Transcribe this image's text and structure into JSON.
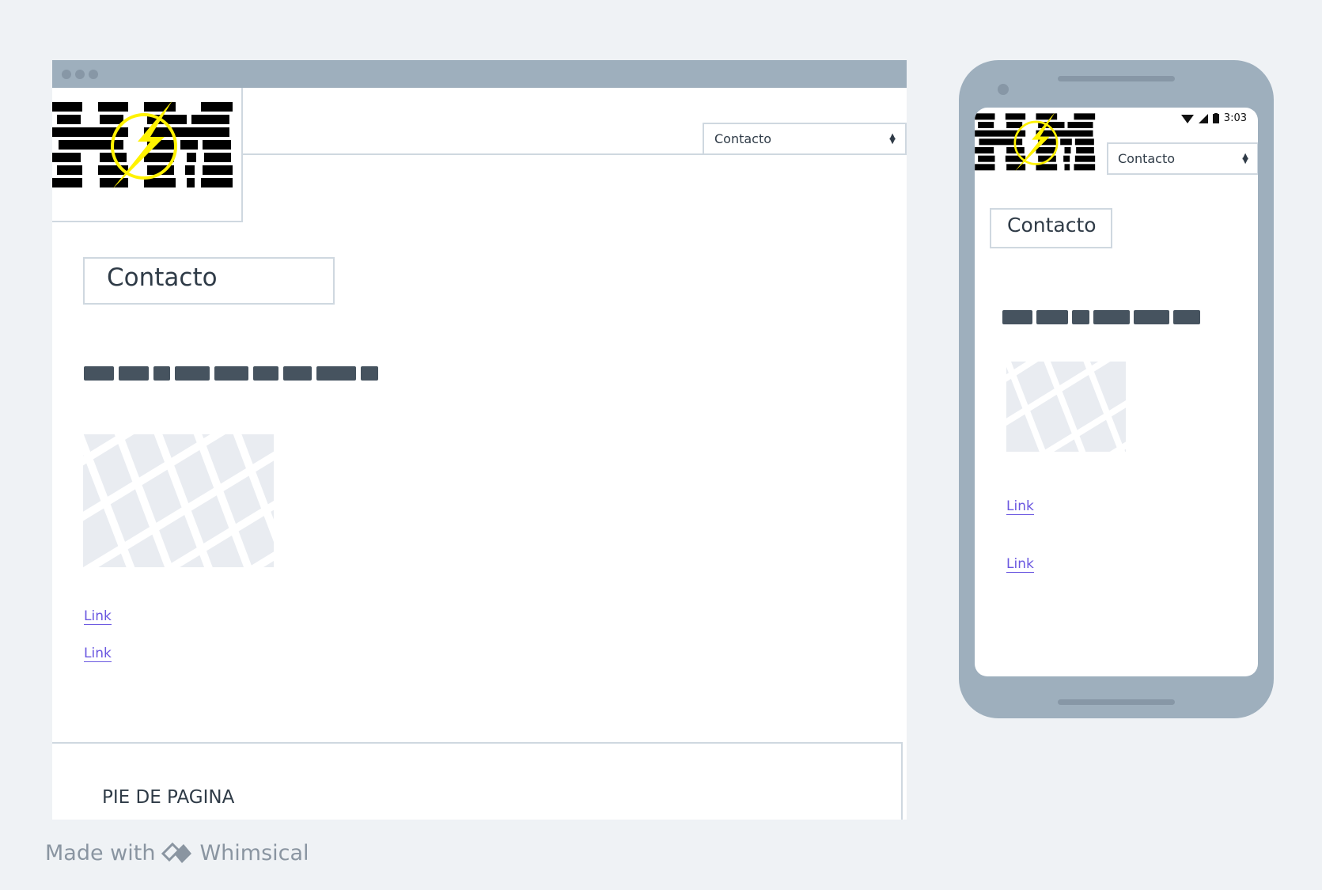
{
  "desktop": {
    "logo": {
      "text": "HM"
    },
    "nav_select": {
      "value": "Contacto"
    },
    "page_title": "Contacto",
    "links": [
      "Link",
      "Link"
    ],
    "footer": {
      "text": "PIE DE PAGINA"
    }
  },
  "mobile": {
    "status": {
      "time": "3:03"
    },
    "nav_select": {
      "value": "Contacto"
    },
    "page_title": "Contacto",
    "links": [
      "Link",
      "Link"
    ]
  },
  "watermark": {
    "prefix": "Made with",
    "brand": "Whimsical"
  },
  "colors": {
    "frame": "#9eafbd",
    "background": "#eff2f5",
    "border": "#cfd8e0",
    "text": "#2f3b47",
    "placeholder_bar": "#46535f",
    "link": "#6a57e0",
    "logo_bolt": "#fff200"
  }
}
